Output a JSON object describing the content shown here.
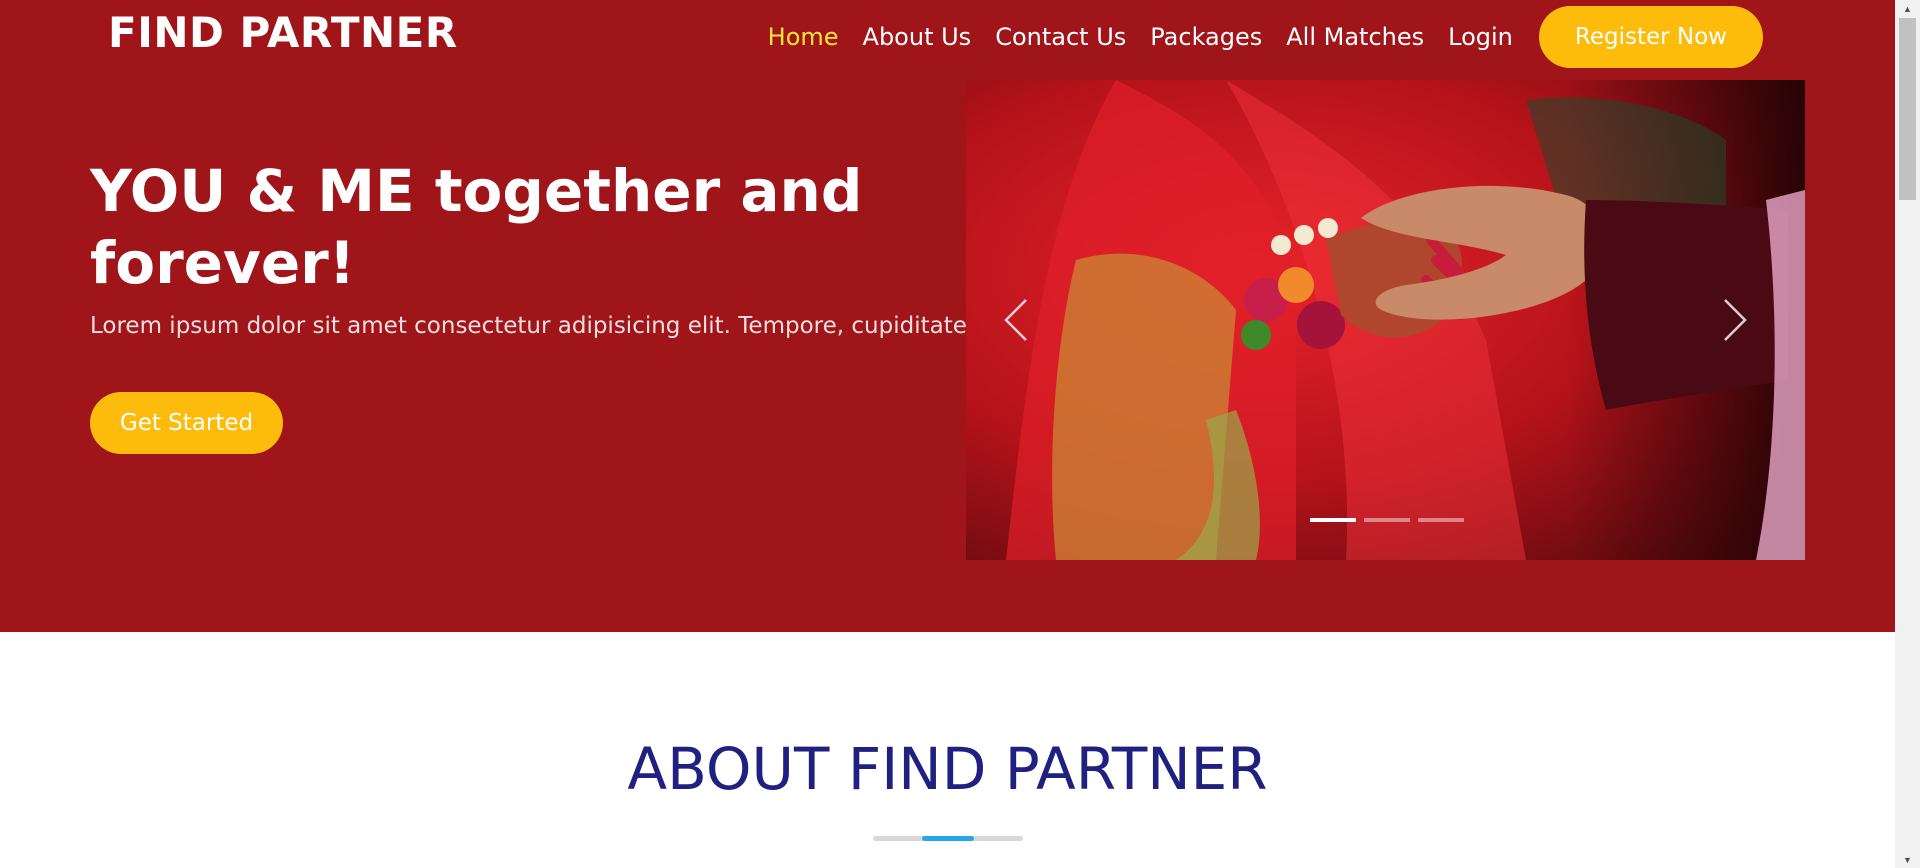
{
  "header": {
    "brand": "FIND PARTNER",
    "nav": [
      {
        "label": "Home"
      },
      {
        "label": "About Us"
      },
      {
        "label": "Contact Us"
      },
      {
        "label": "Packages"
      },
      {
        "label": "All Matches"
      },
      {
        "label": "Login"
      }
    ],
    "register_label": "Register Now"
  },
  "hero": {
    "headline": "YOU & ME together and forever!",
    "lead": "Lorem ipsum dolor sit amet consectetur adipisicing elit. Tempore, cupiditate?",
    "cta_label": "Get Started"
  },
  "carousel": {
    "slide_count": 3,
    "active_slide": 1
  },
  "about": {
    "title": "ABOUT FIND PARTNER"
  },
  "colors": {
    "hero_bg": "#a0151a",
    "accent_yellow": "#fdbb0b",
    "active_nav": "#ffe335",
    "about_title": "#1f2180",
    "divider_accent": "#27a6e6"
  }
}
